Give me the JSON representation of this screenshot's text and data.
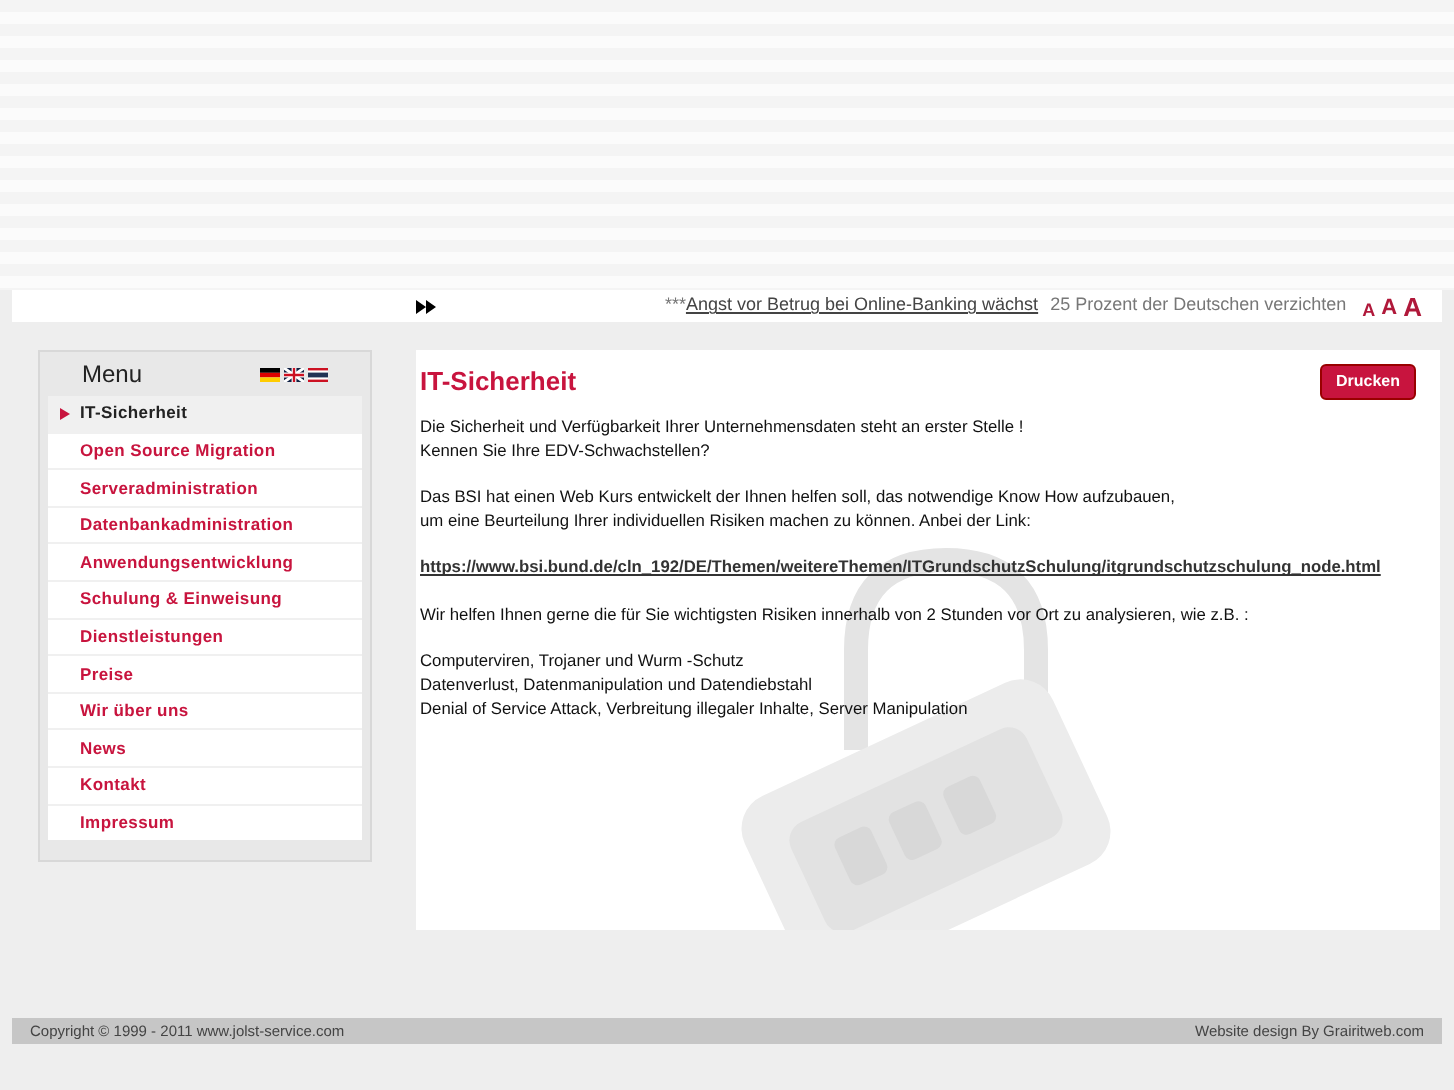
{
  "ticker": {
    "prefix": "***",
    "headline": "Angst vor Betrug bei Online-Banking wächst",
    "teaser": "25 Prozent der Deutschen verzichten",
    "font_sizes": [
      "A",
      "A",
      "A"
    ]
  },
  "menu": {
    "title": "Menu",
    "items": [
      {
        "label": "IT-Sicherheit",
        "selected": true
      },
      {
        "label": "Open Source Migration",
        "selected": false
      },
      {
        "label": "Serveradministration",
        "selected": false
      },
      {
        "label": "Datenbankadministration",
        "selected": false
      },
      {
        "label": "Anwendungsentwicklung",
        "selected": false
      },
      {
        "label": "Schulung & Einweisung",
        "selected": false
      },
      {
        "label": "Dienstleistungen",
        "selected": false
      },
      {
        "label": "Preise",
        "selected": false
      },
      {
        "label": "Wir über uns",
        "selected": false
      },
      {
        "label": "News",
        "selected": false
      },
      {
        "label": "Kontakt",
        "selected": false
      },
      {
        "label": "Impressum",
        "selected": false
      }
    ]
  },
  "content": {
    "title": "IT-Sicherheit",
    "print_button": "Drucken",
    "paragraphs": [
      {
        "kind": "text",
        "lines": [
          "Die Sicherheit und Verfügbarkeit Ihrer Unternehmensdaten steht an erster Stelle !",
          "Kennen Sie Ihre EDV-Schwachstellen?"
        ]
      },
      {
        "kind": "text",
        "lines": [
          "Das BSI hat einen Web Kurs entwickelt der Ihnen helfen soll, das notwendige Know How aufzubauen,",
          "um eine Beurteilung Ihrer individuellen Risiken machen zu können. Anbei der Link:"
        ]
      },
      {
        "kind": "link",
        "lines": [
          "https://www.bsi.bund.de/cln_192/DE/Themen/weitereThemen/ITGrundschutzSchulung/itgrundschutzschulung_node.html"
        ]
      },
      {
        "kind": "text",
        "lines": [
          "Wir helfen Ihnen gerne die für Sie wichtigsten Risiken innerhalb von 2 Stunden vor Ort zu analysieren, wie z.B. :"
        ]
      },
      {
        "kind": "text",
        "lines": [
          "Computerviren, Trojaner und Wurm -Schutz",
          "Datenverlust, Datenmanipulation und Datendiebstahl",
          "Denial of Service Attack, Verbreitung illegaler Inhalte, Server Manipulation"
        ]
      }
    ]
  },
  "footer": {
    "copyright": "Copyright © 1999 - 2011 www.jolst-service.com",
    "credit": "Website design By Grairitweb.com"
  }
}
